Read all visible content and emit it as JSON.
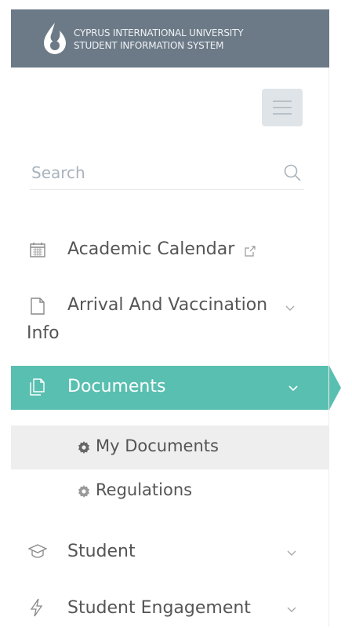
{
  "header": {
    "brand_line1": "CYPRUS INTERNATIONAL UNIVERSITY",
    "brand_line2": "STUDENT INFORMATION SYSTEM",
    "bg_color": "#6c7a87"
  },
  "search": {
    "placeholder": "Search",
    "icon": "search-icon"
  },
  "menu": {
    "academic_calendar": {
      "label": "Academic Calendar",
      "icon": "calendar-icon"
    },
    "arrival": {
      "label_line1": "Arrival And Vaccination",
      "label_line2": "Info",
      "icon": "file-icon"
    },
    "documents": {
      "label": "Documents",
      "icon": "documents-icon",
      "active": true
    },
    "sub": [
      {
        "label": "My Documents",
        "icon": "gear-icon"
      },
      {
        "label": "Regulations",
        "icon": "gear-icon"
      }
    ],
    "student": {
      "label": "Student",
      "icon": "graduation-cap-icon"
    },
    "engagement": {
      "label": "Student Engagement",
      "icon": "bolt-icon"
    }
  },
  "colors": {
    "accent": "#59bfb0",
    "text": "#555555",
    "icon": "#888888"
  }
}
